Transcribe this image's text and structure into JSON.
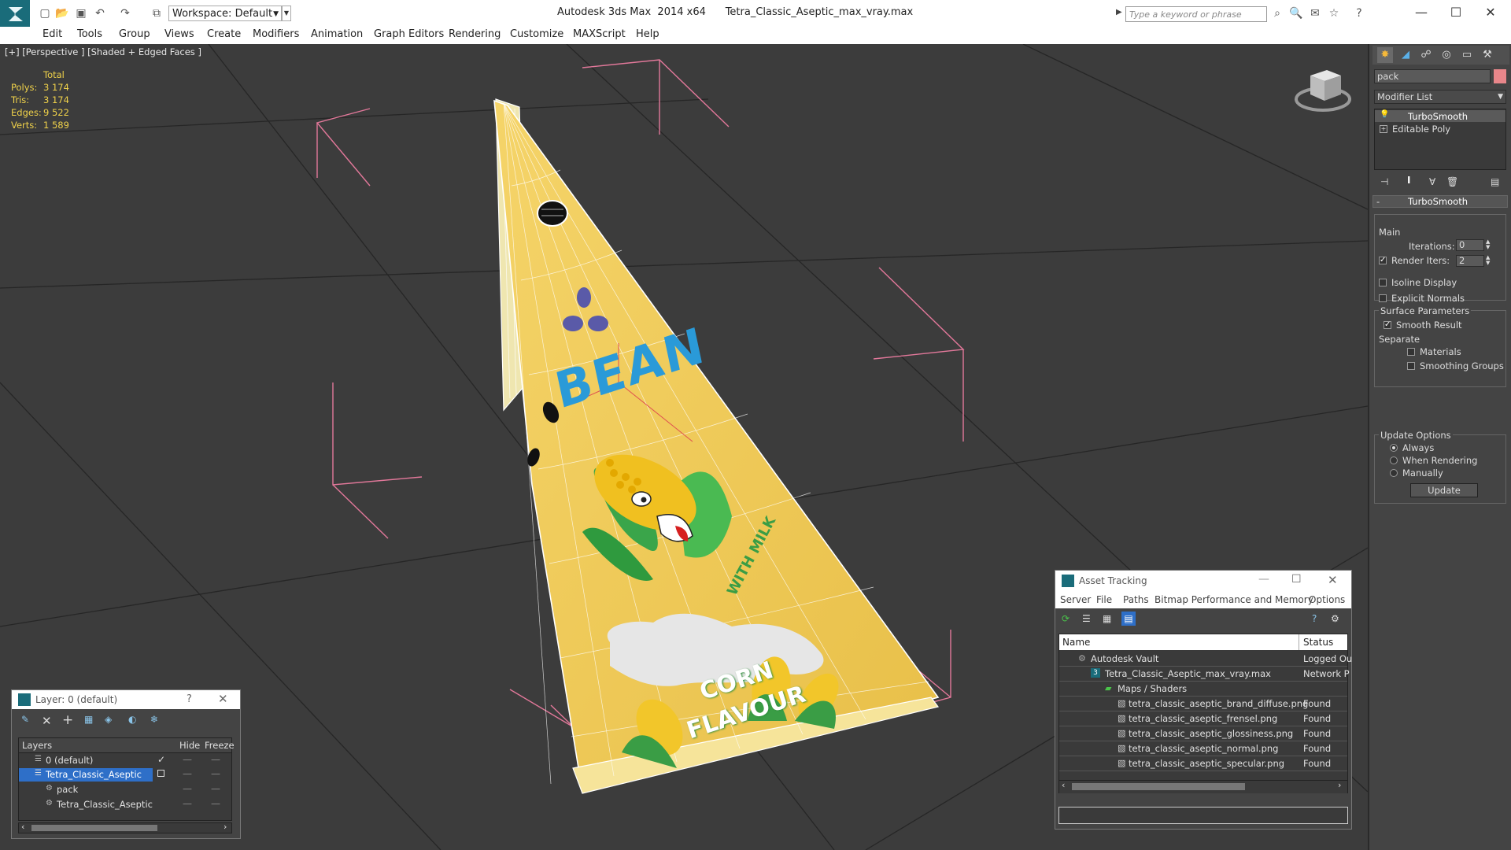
{
  "window": {
    "app_title": "Autodesk 3ds Max  2014 x64",
    "file_title": "Tetra_Classic_Aseptic_max_vray.max",
    "workspace": "Workspace: Default",
    "search_placeholder": "Type a keyword or phrase"
  },
  "menu": [
    "Edit",
    "Tools",
    "Group",
    "Views",
    "Create",
    "Modifiers",
    "Animation",
    "Graph Editors",
    "Rendering",
    "Customize",
    "MAXScript",
    "Help"
  ],
  "viewport": {
    "label": "[+] [Perspective ] [Shaded + Edged Faces ]",
    "stats": {
      "header": "Total",
      "rows": [
        {
          "label": "Polys:",
          "value": "3 174"
        },
        {
          "label": "Tris:",
          "value": "3 174"
        },
        {
          "label": "Edges:",
          "value": "9 522"
        },
        {
          "label": "Verts:",
          "value": "1 589"
        }
      ]
    },
    "pack_texts": {
      "brand": "BEAN",
      "side": "WITH MILK",
      "flavour_line1": "CORN",
      "flavour_line2": "FLAVOUR"
    }
  },
  "command_panel": {
    "object_name": "pack",
    "modifier_list": "Modifier List",
    "stack": [
      "TurboSmooth",
      "Editable Poly"
    ],
    "rollout_title": "TurboSmooth",
    "main_label": "Main",
    "iterations_label": "Iterations:",
    "iterations_value": "0",
    "render_iters_label": "Render Iters:",
    "render_iters_value": "2",
    "isoline_label": "Isoline Display",
    "explicit_normals_label": "Explicit Normals",
    "surface_params_label": "Surface Parameters",
    "smooth_result_label": "Smooth Result",
    "separate_label": "Separate",
    "materials_label": "Materials",
    "smoothing_groups_label": "Smoothing Groups",
    "update_options_label": "Update Options",
    "always_label": "Always",
    "when_rendering_label": "When Rendering",
    "manually_label": "Manually",
    "update_button": "Update",
    "colors": {
      "object_color": "#e8868a"
    }
  },
  "layer_window": {
    "title": "Layer: 0 (default)",
    "help": "?",
    "columns": [
      "Layers",
      "Hide",
      "Freeze"
    ],
    "rows": [
      {
        "name": "0 (default)",
        "indent": 1
      },
      {
        "name": "Tetra_Classic_Aseptic",
        "indent": 1
      },
      {
        "name": "pack",
        "indent": 2
      },
      {
        "name": "Tetra_Classic_Aseptic",
        "indent": 2
      }
    ]
  },
  "asset_window": {
    "title": "Asset Tracking",
    "menu": [
      "Server",
      "File",
      "Paths",
      "Bitmap Performance and Memory",
      "Options"
    ],
    "columns": [
      "Name",
      "Status"
    ],
    "rows": [
      {
        "name": "Autodesk Vault",
        "status": "Logged Ou"
      },
      {
        "name": "Tetra_Classic_Aseptic_max_vray.max",
        "status": "Network P"
      },
      {
        "name": "Maps / Shaders",
        "status": ""
      },
      {
        "name": "tetra_classic_aseptic_brand_diffuse.png",
        "status": "Found"
      },
      {
        "name": "tetra_classic_aseptic_frensel.png",
        "status": "Found"
      },
      {
        "name": "tetra_classic_aseptic_glossiness.png",
        "status": "Found"
      },
      {
        "name": "tetra_classic_aseptic_normal.png",
        "status": "Found"
      },
      {
        "name": "tetra_classic_aseptic_specular.png",
        "status": "Found"
      }
    ]
  }
}
